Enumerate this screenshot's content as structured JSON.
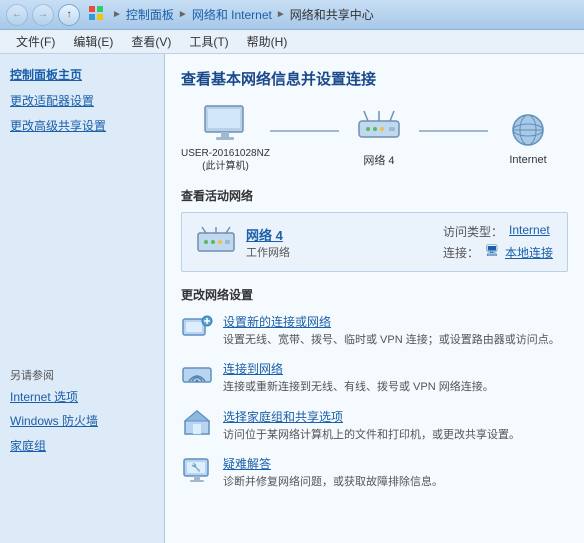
{
  "titlebar": {
    "breadcrumbs": [
      "控制面板",
      "网络和 Internet",
      "网络和共享中心"
    ]
  },
  "menubar": {
    "items": [
      {
        "label": "文件(F)"
      },
      {
        "label": "编辑(E)"
      },
      {
        "label": "查看(V)"
      },
      {
        "label": "工具(T)"
      },
      {
        "label": "帮助(H)"
      }
    ]
  },
  "sidebar": {
    "title": "控制面板主页",
    "links": [
      {
        "label": "更改适配器设置"
      },
      {
        "label": "更改高级共享设置"
      }
    ],
    "also_see_title": "另请参阅",
    "also_see_links": [
      {
        "label": "Internet 选项"
      },
      {
        "label": "Windows 防火墙"
      },
      {
        "label": "家庭组"
      }
    ]
  },
  "content": {
    "page_title": "查看基本网络信息并设置连接",
    "diagram": {
      "nodes": [
        {
          "label": "USER-20161028NZ\n(此计算机)"
        },
        {
          "label": "网络 4"
        },
        {
          "label": "Internet"
        }
      ]
    },
    "active_network_title": "查看活动网络",
    "network_card": {
      "name": "网络 4",
      "type": "工作网络",
      "access_label": "访问类型：",
      "access_value": "Internet",
      "connection_label": "连接：",
      "connection_value": "本地连接"
    },
    "change_settings_title": "更改网络设置",
    "settings": [
      {
        "link": "设置新的连接或网络",
        "desc": "设置无线、宽带、拨号、临时或 VPN 连接；或设置路由器或访问点。"
      },
      {
        "link": "连接到网络",
        "desc": "连接或重新连接到无线、有线、拨号或 VPN 网络连接。"
      },
      {
        "link": "选择家庭组和共享选项",
        "desc": "访问位于某网络计算机上的文件和打印机，或更改共享设置。"
      },
      {
        "link": "疑难解答",
        "desc": "诊断并修复网络问题，或获取故障排除信息。"
      }
    ]
  },
  "colors": {
    "accent": "#1a5fa8",
    "sidebar_bg": "#ddeaf8",
    "content_bg": "#f5faff"
  }
}
